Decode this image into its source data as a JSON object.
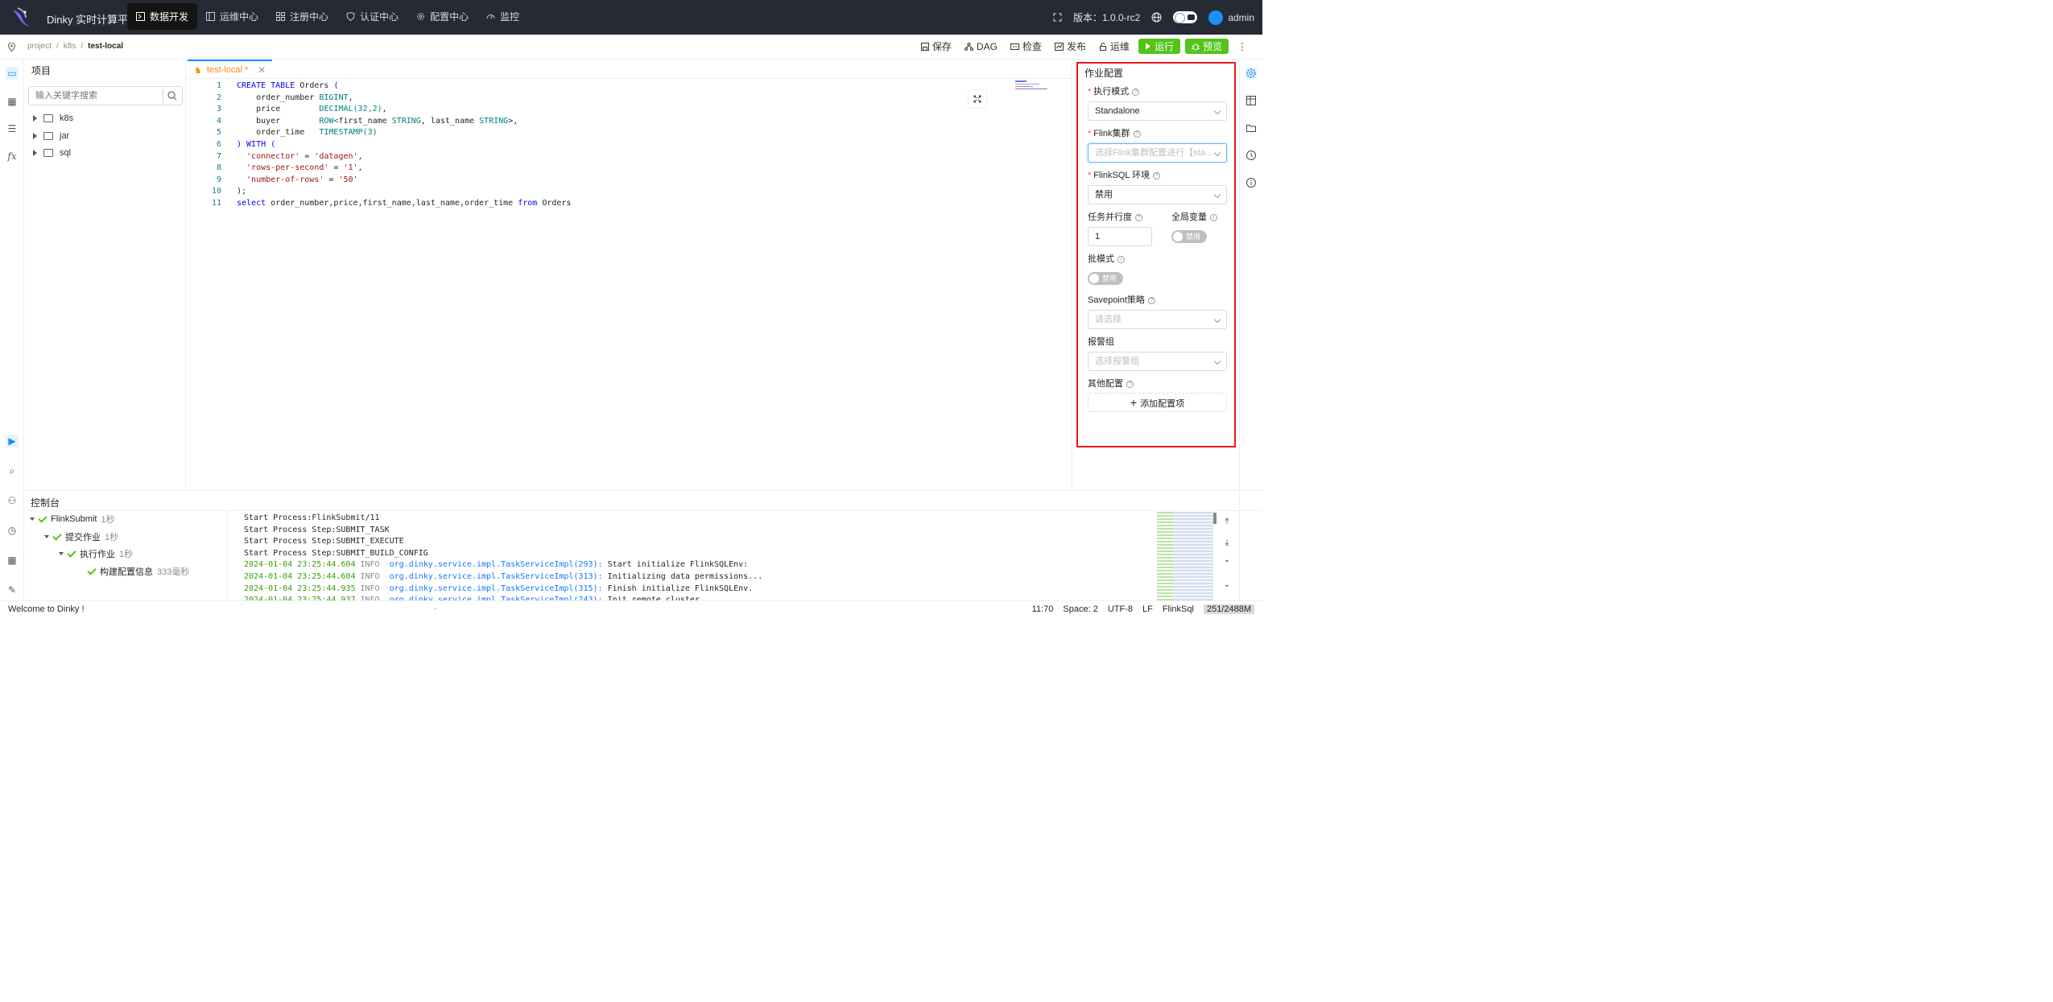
{
  "app": {
    "title": "Dinky 实时计算平台"
  },
  "nav": [
    {
      "label": "数据开发",
      "icon": "code-square-icon",
      "active": true
    },
    {
      "label": "运维中心",
      "icon": "layout-icon"
    },
    {
      "label": "注册中心",
      "icon": "grid-icon"
    },
    {
      "label": "认证中心",
      "icon": "shield-icon"
    },
    {
      "label": "配置中心",
      "icon": "gear-icon"
    },
    {
      "label": "监控",
      "icon": "dashboard-icon"
    }
  ],
  "header_right": {
    "version": "版本：1.0.0-rc2",
    "user": "admin"
  },
  "breadcrumb": [
    "project",
    "/",
    "k8s",
    "/",
    "test-local"
  ],
  "toolbar": {
    "save": "保存",
    "dag": "DAG",
    "check": "检查",
    "publish": "发布",
    "ops": "运维",
    "run": "运行",
    "preview": "预览"
  },
  "project": {
    "title": "项目",
    "search_placeholder": "输入关键字搜索",
    "tree": [
      "k8s",
      "jar",
      "sql"
    ]
  },
  "editor": {
    "tab": "test-local *",
    "lines": [
      [
        {
          "t": "CREATE TABLE ",
          "c": "kw"
        },
        {
          "t": "Orders ",
          "c": ""
        },
        {
          "t": "(",
          "c": "kw"
        }
      ],
      [
        {
          "t": "    order_number ",
          "c": ""
        },
        {
          "t": "BIGINT",
          "c": "ty"
        },
        {
          "t": ",",
          "c": ""
        }
      ],
      [
        {
          "t": "    price        ",
          "c": ""
        },
        {
          "t": "DECIMAL(32,2)",
          "c": "ty"
        },
        {
          "t": ",",
          "c": ""
        }
      ],
      [
        {
          "t": "    buyer        ",
          "c": ""
        },
        {
          "t": "ROW<",
          "c": "ty"
        },
        {
          "t": "first_name ",
          "c": ""
        },
        {
          "t": "STRING",
          "c": "ty"
        },
        {
          "t": ", last_name ",
          "c": ""
        },
        {
          "t": "STRING",
          "c": "ty"
        },
        {
          "t": ">,",
          "c": ""
        }
      ],
      [
        {
          "t": "    order_time   ",
          "c": ""
        },
        {
          "t": "TIMESTAMP(3)",
          "c": "ty"
        }
      ],
      [
        {
          "t": ") WITH (",
          "c": "kw"
        }
      ],
      [
        {
          "t": "  'connector'",
          "c": "st"
        },
        {
          "t": " = ",
          "c": ""
        },
        {
          "t": "'datagen'",
          "c": "st"
        },
        {
          "t": ",",
          "c": ""
        }
      ],
      [
        {
          "t": "  'rows-per-second'",
          "c": "st"
        },
        {
          "t": " = ",
          "c": ""
        },
        {
          "t": "'1'",
          "c": "st"
        },
        {
          "t": ",",
          "c": ""
        }
      ],
      [
        {
          "t": "  'number-of-rows'",
          "c": "st"
        },
        {
          "t": " = ",
          "c": ""
        },
        {
          "t": "'50'",
          "c": "st"
        }
      ],
      [
        {
          "t": ");",
          "c": ""
        }
      ],
      [
        {
          "t": "select ",
          "c": "kw"
        },
        {
          "t": "order_number,price,first_name,last_name,order_time ",
          "c": ""
        },
        {
          "t": "from ",
          "c": "kw"
        },
        {
          "t": "Orders",
          "c": ""
        }
      ]
    ]
  },
  "job_config": {
    "title": "作业配置",
    "exec_mode_label": "执行模式",
    "exec_mode_value": "Standalone",
    "cluster_label": "Flink集群",
    "cluster_placeholder": "选择Flink集群配置进行【sta...",
    "env_label": "FlinkSQL 环境",
    "env_value": "禁用",
    "parallelism_label": "任务并行度",
    "parallelism_value": "1",
    "global_var_label": "全局变量",
    "switch_off": "禁用",
    "batch_label": "批模式",
    "savepoint_label": "Savepoint策略",
    "savepoint_placeholder": "请选择",
    "alert_label": "报警组",
    "alert_placeholder": "选择报警组",
    "other_label": "其他配置",
    "add_button": "添加配置项"
  },
  "console": {
    "title": "控制台",
    "tree": [
      {
        "label": "FlinkSubmit",
        "time": "1秒"
      },
      {
        "label": "提交作业",
        "time": "1秒"
      },
      {
        "label": "执行作业",
        "time": "1秒"
      },
      {
        "label": "构建配置信息",
        "time": "333毫秒"
      }
    ],
    "log": [
      {
        "plain": "Start Process:FlinkSubmit/11"
      },
      {
        "plain": "Start Process Step:SUBMIT_TASK"
      },
      {
        "plain": "Start Process Step:SUBMIT_EXECUTE"
      },
      {
        "plain": "Start Process Step:SUBMIT_BUILD_CONFIG"
      },
      {
        "time": "2024-01-04 23:25:44.604",
        "level": "INFO",
        "cls": "org.dinky.service.impl.TaskServiceImpl(293):",
        "msg": "Start initialize FlinkSQLEnv:"
      },
      {
        "time": "2024-01-04 23:25:44.604",
        "level": "INFO",
        "cls": "org.dinky.service.impl.TaskServiceImpl(313):",
        "msg": "Initializing data permissions..."
      },
      {
        "time": "2024-01-04 23:25:44.935",
        "level": "INFO",
        "cls": "org.dinky.service.impl.TaskServiceImpl(315):",
        "msg": "Finish initialize FlinkSQLEnv."
      },
      {
        "time": "2024-01-04 23:25:44.937",
        "level": "INFO",
        "cls": "org.dinky.service.impl.TaskServiceImpl(243):",
        "msg": "Init remote cluster"
      }
    ]
  },
  "status": {
    "welcome": "Welcome to Dinky !",
    "middle": "-",
    "cursor": "11:70",
    "space": "Space: 2",
    "encoding": "UTF-8",
    "eol": "LF",
    "lang": "FlinkSql",
    "memory": "251/2488M"
  }
}
